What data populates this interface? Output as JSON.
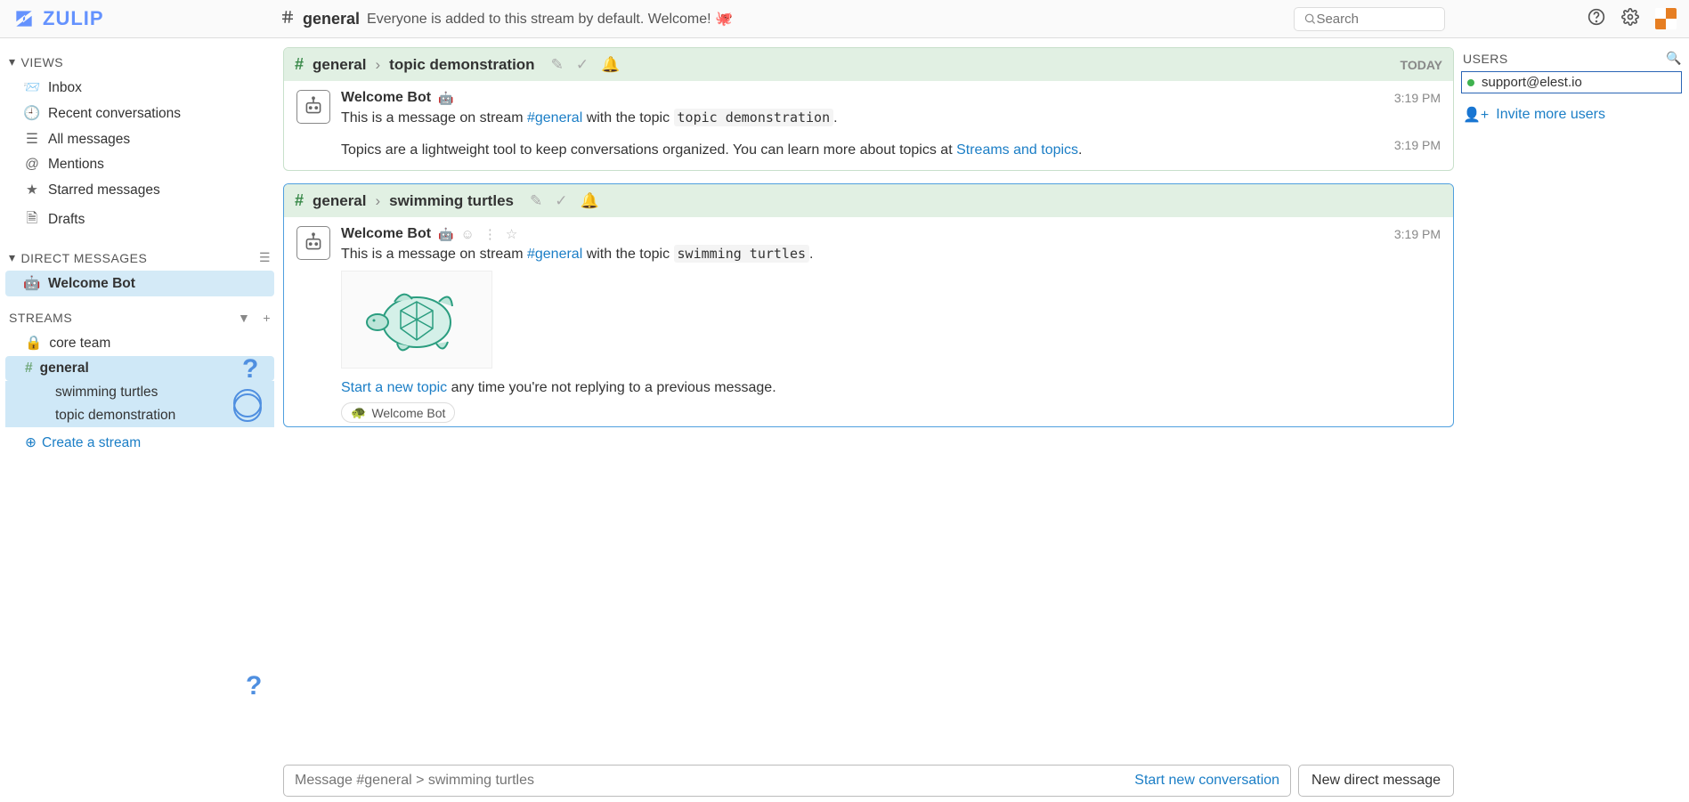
{
  "logo_text": "ZULIP",
  "header": {
    "stream": "general",
    "description": "Everyone is added to this stream by default. Welcome!",
    "emoji": "🐙"
  },
  "search_placeholder": "Search",
  "sidebar": {
    "views_label": "VIEWS",
    "views": [
      {
        "label": "Inbox",
        "icon": "inbox"
      },
      {
        "label": "Recent conversations",
        "icon": "clock"
      },
      {
        "label": "All messages",
        "icon": "align"
      },
      {
        "label": "Mentions",
        "icon": "at"
      },
      {
        "label": "Starred messages",
        "icon": "star"
      },
      {
        "label": "Drafts",
        "icon": "draft"
      }
    ],
    "dm_label": "DIRECT MESSAGES",
    "dm_items": [
      {
        "label": "Welcome Bot",
        "active": true
      }
    ],
    "streams_label": "STREAMS",
    "streams": [
      {
        "label": "core team",
        "private": true
      },
      {
        "label": "general",
        "private": false,
        "active": true,
        "topics": [
          "swimming turtles",
          "topic demonstration"
        ]
      }
    ],
    "create_stream": "Create a stream"
  },
  "messages": {
    "group1": {
      "stream": "general",
      "topic": "topic demonstration",
      "date_label": "TODAY",
      "rows": [
        {
          "sender": "Welcome Bot",
          "time": "3:19 PM",
          "text_prefix": "This is a message on stream ",
          "stream_link": "#general",
          "text_mid": " with the topic ",
          "code": "topic demonstration",
          "text_suffix": "."
        },
        {
          "time": "3:19 PM",
          "text_a": "Topics are a lightweight tool to keep conversations organized. You can learn more about topics at ",
          "link": "Streams and topics",
          "text_b": "."
        }
      ]
    },
    "group2": {
      "stream": "general",
      "topic": "swimming turtles",
      "rows": [
        {
          "sender": "Welcome Bot",
          "time": "3:19 PM",
          "text_prefix": "This is a message on stream ",
          "stream_link": "#general",
          "text_mid": " with the topic ",
          "code": "swimming turtles",
          "text_suffix": "."
        }
      ],
      "footer_link": "Start a new topic",
      "footer_text": " any time you're not replying to a previous message.",
      "reaction": "Welcome Bot"
    }
  },
  "compose": {
    "placeholder": "Message #general > swimming turtles",
    "start_new": "Start new conversation",
    "new_dm": "New direct message"
  },
  "right": {
    "users_label": "USERS",
    "user": "support@elest.io",
    "invite": "Invite more users"
  }
}
